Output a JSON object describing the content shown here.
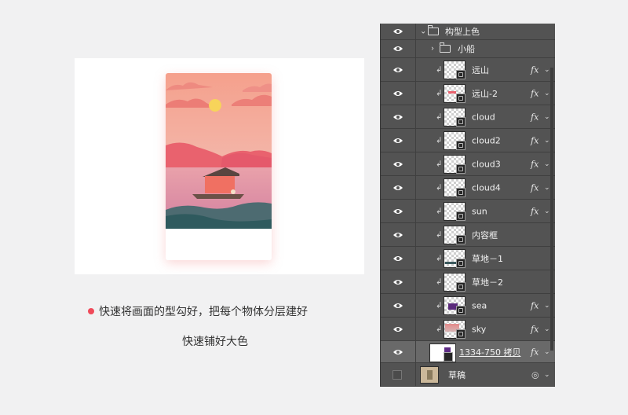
{
  "caption": {
    "line1": "快速将画面的型勾好，把每个物体分层建好",
    "line2": "快速铺好大色",
    "bullet_color": "#f04a5a"
  },
  "illustration": {
    "sky_top": "#f6a28b",
    "sky_bottom": "#f3bdb2",
    "sun_color": "#f7d45a",
    "mountain_color": "#e9626e",
    "sea_color": "#4f5b6b",
    "boat_roof": "#5a4540",
    "boat_cabin": "#f07062"
  },
  "layers_panel": {
    "group": {
      "name": "构型上色",
      "expanded": true
    },
    "subgroup": {
      "name": "小船",
      "expanded": false
    },
    "layers": [
      {
        "name": "远山",
        "fx": "fx"
      },
      {
        "name": "远山-2",
        "fx": "fx"
      },
      {
        "name": "cloud",
        "fx": "fx"
      },
      {
        "name": "cloud2",
        "fx": "fx"
      },
      {
        "name": "cloud3",
        "fx": "fx"
      },
      {
        "name": "cloud4",
        "fx": "fx"
      },
      {
        "name": "sun",
        "fx": "fx"
      },
      {
        "name": "内容框",
        "fx": ""
      },
      {
        "name": "草地－1",
        "fx": ""
      },
      {
        "name": "草地－2",
        "fx": ""
      },
      {
        "name": "sea",
        "fx": "fx"
      },
      {
        "name": "sky",
        "fx": "fx"
      }
    ],
    "base_layer": {
      "name": "1334-750 拷贝",
      "fx": "fx"
    },
    "draft_layer": {
      "name": "草稿",
      "visible": false
    }
  }
}
